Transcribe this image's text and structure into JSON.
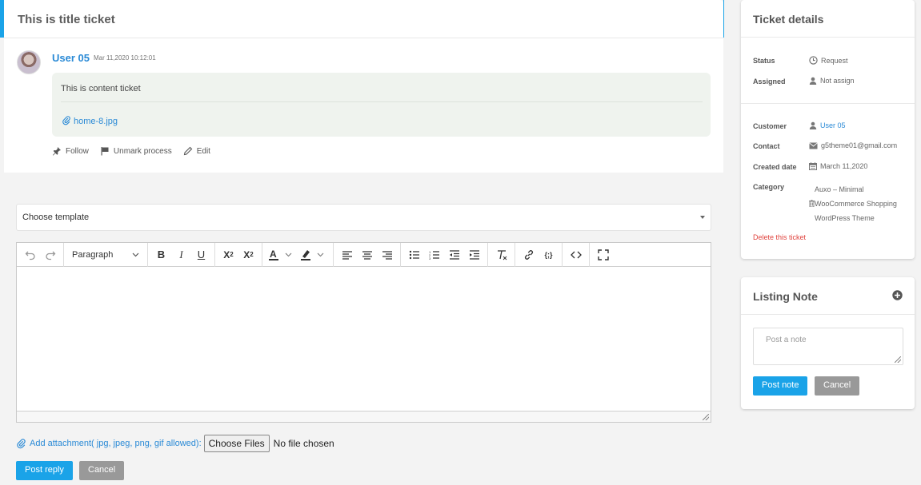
{
  "ticket": {
    "title": "This is title ticket",
    "user_name": "User 05",
    "timestamp": "Mar 11,2020 10:12:01",
    "content": "This is content ticket",
    "attachment": "home-8.jpg",
    "actions": {
      "follow": "Follow",
      "unmark": "Unmark process",
      "edit": "Edit"
    }
  },
  "reply": {
    "template_select": "Choose template",
    "editor": {
      "block_format": "Paragraph"
    },
    "attachment_label": "Add attachment( jpg, jpeg, png, gif allowed):",
    "choose_files": "Choose Files",
    "file_status": "No file chosen",
    "post_reply": "Post reply",
    "cancel": "Cancel"
  },
  "details": {
    "heading": "Ticket details",
    "labels": {
      "status": "Status",
      "assigned": "Assigned",
      "customer": "Customer",
      "contact": "Contact",
      "created": "Created date",
      "category": "Category"
    },
    "values": {
      "status": "Request",
      "assigned": "Not assign",
      "customer": "User 05",
      "contact": "g5theme01@gmail.com",
      "created": "March 11,2020",
      "category": [
        "Auxo – Minimal",
        "WooCommerce Shopping",
        "WordPress Theme"
      ]
    },
    "delete": "Delete this ticket"
  },
  "notes": {
    "heading": "Listing Note",
    "placeholder": "Post a note",
    "post": "Post note",
    "cancel": "Cancel"
  },
  "colors": {
    "accent": "#1aa3e8",
    "link": "#2a8ad6",
    "danger": "#e0443f",
    "muted_button": "#999999"
  },
  "icons": [
    "pin-icon",
    "flag-icon",
    "pencil-icon",
    "paperclip-icon",
    "clock-icon",
    "user-icon",
    "envelope-icon",
    "calendar-icon",
    "trash-icon",
    "plus-circle-icon"
  ]
}
